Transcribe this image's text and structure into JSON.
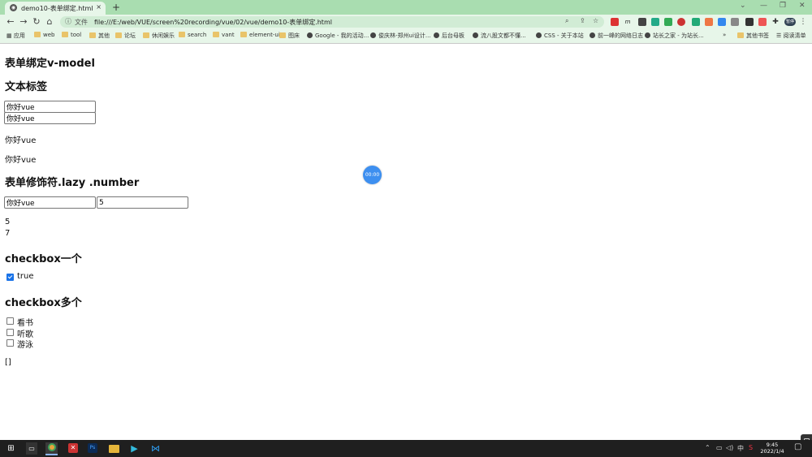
{
  "browser": {
    "tab_title": "demo10-表单绑定.html",
    "tab_close": "×",
    "new_tab": "+",
    "window_controls": [
      "⌄",
      "—",
      "❐",
      "✕"
    ],
    "address_label": "文件",
    "url": "file:///E:/web/VUE/screen%20recording/vue/02/vue/demo10-表单绑定.html",
    "profile_label": "暂停",
    "bookmarks": [
      "应用",
      "web",
      "tool",
      "其他",
      "论坛",
      "休闲娱乐",
      "search",
      "vant",
      "element-ui",
      "图床",
      "Google - 我的活动...",
      "俊庆林-郑州ui设计...",
      "后台母板",
      "流八股文都不懂...",
      "CSS - 关于本站",
      "前一峰的网络日志",
      "站长之家 - 为站长...",
      "»",
      "其他书签",
      "阅读清单"
    ]
  },
  "page": {
    "title": "表单绑定v-model",
    "section_text": {
      "heading": "文本标签",
      "input1_value": "你好vue",
      "input2_value": "你好vue",
      "para1": "你好vue",
      "para2": "你好vue"
    },
    "section_modifiers": {
      "heading": "表单修饰符.lazy .number",
      "lazy_value": "你好vue",
      "number_value": "5",
      "output1": "5",
      "output2": "7"
    },
    "section_checkbox_single": {
      "heading": "checkbox一个",
      "checked": true,
      "label": "true"
    },
    "section_checkbox_multi": {
      "heading": "checkbox多个",
      "options": [
        {
          "label": "看书",
          "checked": false
        },
        {
          "label": "听歌",
          "checked": false
        },
        {
          "label": "游泳",
          "checked": false
        }
      ],
      "output": "[]"
    }
  },
  "overlay": {
    "timer": "00:00"
  },
  "taskbar": {
    "tray_ime": "中",
    "time": "9:45",
    "date": "2022/1/4"
  },
  "colors": {
    "chrome_green": "#b6e3b0",
    "accent_blue": "#1a73e8",
    "timer_blue": "#3d8ff0",
    "taskbar": "#1f1f1f"
  }
}
